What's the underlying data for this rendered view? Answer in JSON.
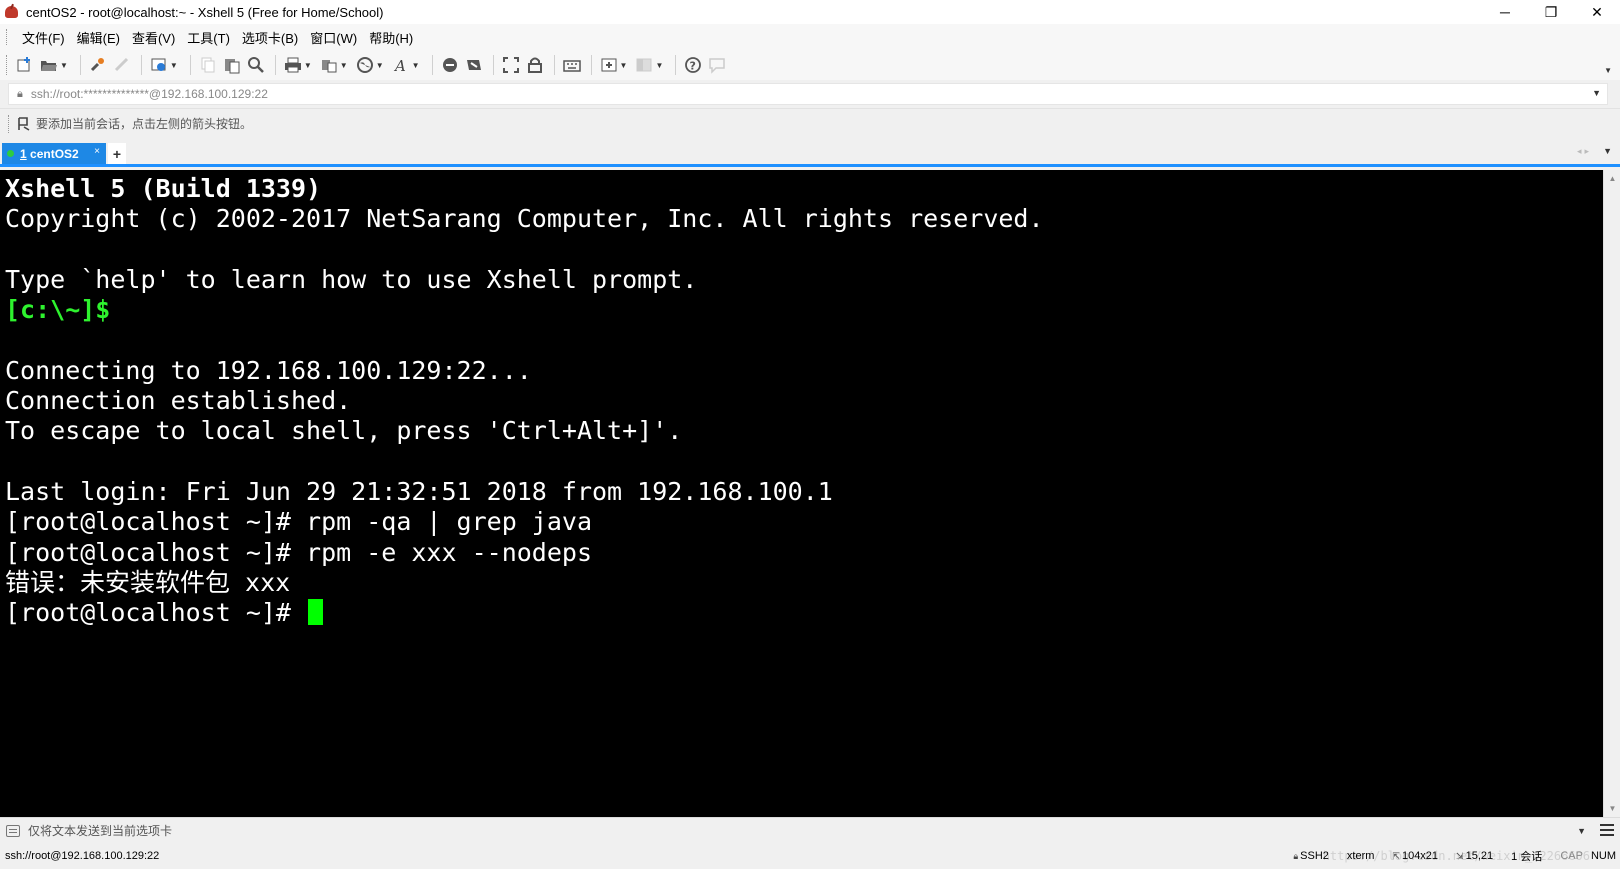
{
  "window": {
    "title": "centOS2 - root@localhost:~ - Xshell 5 (Free for Home/School)",
    "controls": {
      "minimize": "─",
      "restore": "❐",
      "close": "✕"
    }
  },
  "menu": [
    {
      "label": "文件(F)"
    },
    {
      "label": "编辑(E)"
    },
    {
      "label": "查看(V)"
    },
    {
      "label": "工具(T)"
    },
    {
      "label": "选项卡(B)"
    },
    {
      "label": "窗口(W)"
    },
    {
      "label": "帮助(H)"
    }
  ],
  "toolbar": {
    "icons": [
      "new-session-icon",
      "open-folder-icon",
      "reconnect-icon",
      "disconnect-icon",
      "properties-icon",
      "copy-icon",
      "paste-icon",
      "find-icon",
      "print-icon",
      "transfer-icon",
      "globe-icon",
      "font-icon",
      "xftp-icon",
      "compose-icon",
      "fullscreen-icon",
      "lock-icon",
      "keyboard-icon",
      "add-tab-icon",
      "layout-icon",
      "help-icon",
      "chat-icon"
    ]
  },
  "address": {
    "value": "ssh://root:**************@192.168.100.129:22"
  },
  "hint": {
    "text": "要添加当前会话，点击左侧的箭头按钮。"
  },
  "tabs": [
    {
      "index": "1",
      "label": "centOS2",
      "active": true,
      "close": "×"
    }
  ],
  "tab_add": "+",
  "terminal": {
    "lines": [
      {
        "text": "Xshell 5 (Build 1339)",
        "style": "bold"
      },
      {
        "text": "Copyright (c) 2002-2017 NetSarang Computer, Inc. All rights reserved.",
        "style": "normal"
      },
      {
        "text": "",
        "style": "normal"
      },
      {
        "text": "Type `help' to learn how to use Xshell prompt.",
        "style": "normal"
      },
      {
        "text": "[c:\\~]$",
        "style": "green"
      },
      {
        "text": "",
        "style": "normal"
      },
      {
        "text": "Connecting to 192.168.100.129:22...",
        "style": "normal"
      },
      {
        "text": "Connection established.",
        "style": "normal"
      },
      {
        "text": "To escape to local shell, press 'Ctrl+Alt+]'.",
        "style": "normal"
      },
      {
        "text": "",
        "style": "normal"
      },
      {
        "text": "Last login: Fri Jun 29 21:32:51 2018 from 192.168.100.1",
        "style": "normal"
      },
      {
        "text": "[root@localhost ~]# rpm -qa | grep java",
        "style": "normal"
      },
      {
        "text": "[root@localhost ~]# rpm -e xxx --nodeps",
        "style": "normal"
      },
      {
        "text": "错误：未安装软件包 xxx",
        "style": "normal"
      },
      {
        "text": "[root@localhost ~]# ",
        "style": "normal",
        "cursor": true
      }
    ],
    "cursor_color": "#00ff00",
    "prompt_color": "#2ef22e"
  },
  "compose": {
    "text": "仅将文本发送到当前选项卡"
  },
  "status": {
    "connection": "ssh://root@192.168.100.129:22",
    "protocol": "SSH2",
    "terminal_type": "xterm",
    "size": "104x21",
    "position": "15,21",
    "sessions": "1 会话",
    "cap": "CAP",
    "num": "NUM",
    "watermark": "https://blog.csdn.net/weixin_42266606"
  },
  "colors": {
    "tab_active": "#1e88e5",
    "tab_underline": "#1e90ff",
    "terminal_bg": "#000000",
    "terminal_fg": "#ffffff"
  }
}
